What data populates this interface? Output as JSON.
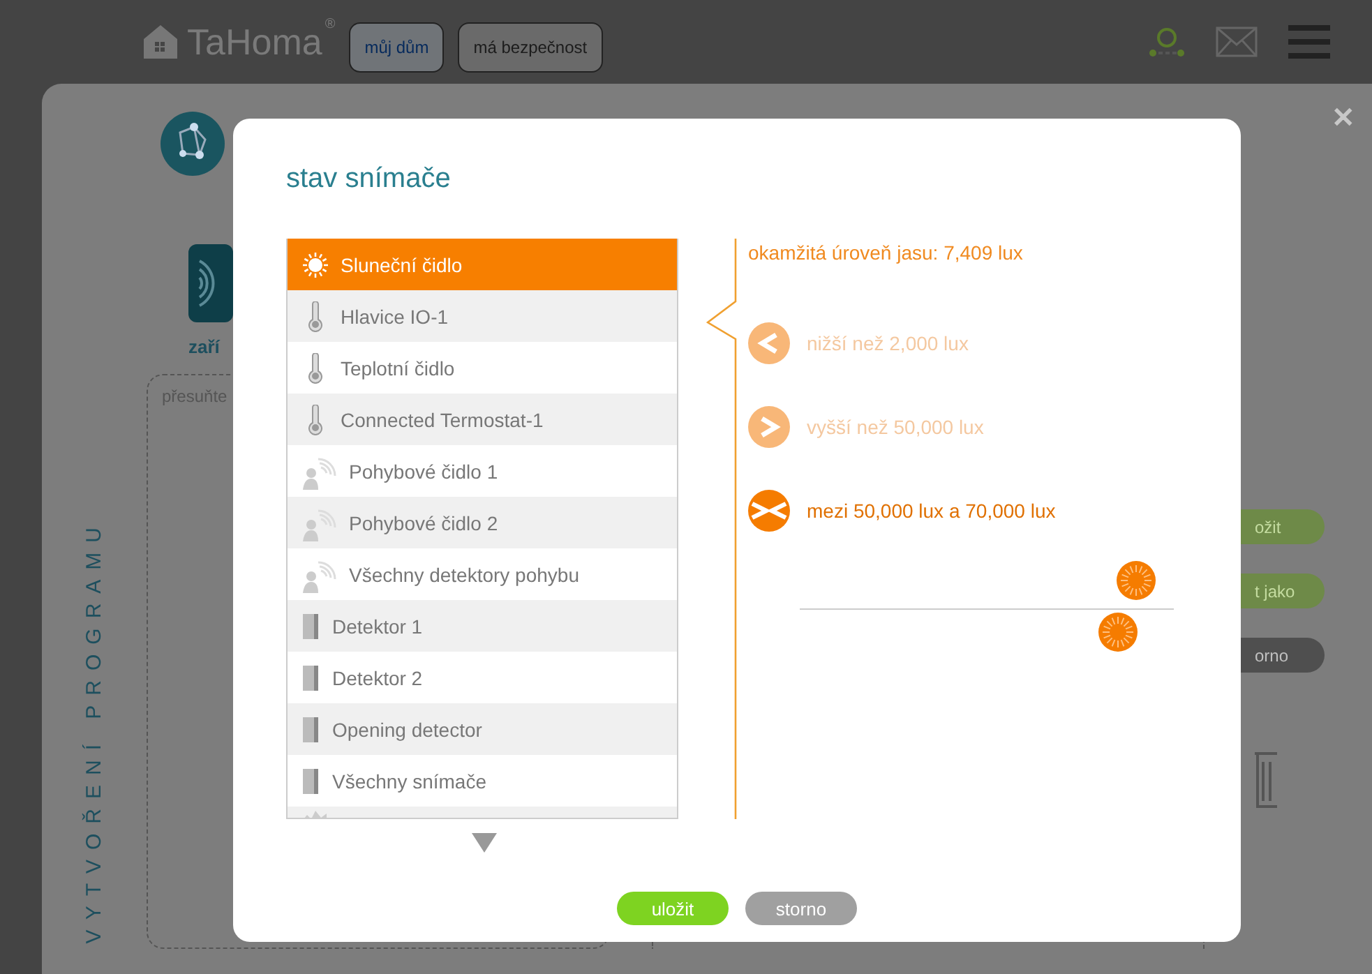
{
  "header": {
    "logo": "TaHoma",
    "logo_mark": "®",
    "tabs": [
      {
        "label": "můj dům",
        "selected": true
      },
      {
        "label": "má bezpečnost",
        "selected": false
      }
    ]
  },
  "background": {
    "close": "✕",
    "device_label": "zaří",
    "drop_hint": "přesuňte",
    "side_title": "VYTVOŘENÍ PROGRAMU",
    "buttons": [
      {
        "label": "ožit",
        "kind": "green"
      },
      {
        "label": "t jako",
        "kind": "green"
      },
      {
        "label": "orno",
        "kind": "dark"
      }
    ]
  },
  "dialog": {
    "title": "stav snímače",
    "sensors": [
      {
        "label": "Sluneční čidlo",
        "kind": "sun",
        "selected": true
      },
      {
        "label": "Hlavice IO-1",
        "kind": "thermometer",
        "selected": false
      },
      {
        "label": "Teplotní čidlo",
        "kind": "thermometer",
        "selected": false
      },
      {
        "label": "Connected Termostat-1",
        "kind": "thermometer",
        "selected": false
      },
      {
        "label": "Pohybové čidlo 1",
        "kind": "motion",
        "selected": false
      },
      {
        "label": "Pohybové čidlo 2",
        "kind": "motion",
        "selected": false
      },
      {
        "label": "Všechny detektory pohybu",
        "kind": "motion",
        "selected": false
      },
      {
        "label": "Detektor 1",
        "kind": "door",
        "selected": false
      },
      {
        "label": "Detektor 2",
        "kind": "door",
        "selected": false
      },
      {
        "label": "Opening detector",
        "kind": "door",
        "selected": false
      },
      {
        "label": "Všechny snímače",
        "kind": "door",
        "selected": false
      },
      {
        "kind": "peaks",
        "selected": false
      }
    ],
    "reading": "okamžitá úroveň jasu: 7,409 lux",
    "conditions": [
      {
        "kind": "below",
        "label": "nižší než 2,000 lux",
        "selected": false
      },
      {
        "kind": "above",
        "label": "vyšší než 50,000 lux",
        "selected": false
      },
      {
        "kind": "between",
        "label": "mezi 50,000 lux a 70,000 lux",
        "selected": true
      }
    ],
    "slider": {
      "thumbs": [
        {
          "level": 0.85
        },
        {
          "level": 0.9
        }
      ]
    },
    "buttons": [
      {
        "label": "uložit",
        "kind": "primary"
      },
      {
        "label": "storno",
        "kind": "secondary"
      }
    ]
  }
}
